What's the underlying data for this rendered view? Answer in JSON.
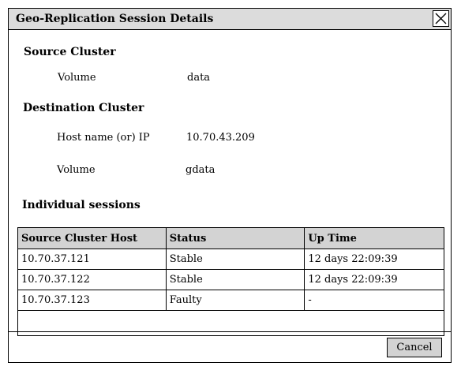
{
  "dialog": {
    "title": "Geo-Replication Session Details",
    "close_icon": "close-icon"
  },
  "source_cluster": {
    "heading": "Source Cluster",
    "volume_label": "Volume",
    "volume_value": "data"
  },
  "destination_cluster": {
    "heading": "Destination Cluster",
    "host_label": "Host name (or) IP",
    "host_value": "10.70.43.209",
    "volume_label": "Volume",
    "volume_value": "gdata"
  },
  "sessions": {
    "heading": "Individual sessions",
    "columns": [
      "Source Cluster Host",
      "Status",
      "Up Time"
    ],
    "rows": [
      [
        "10.70.37.121",
        "Stable",
        "12 days 22:09:39"
      ],
      [
        "10.70.37.122",
        "Stable",
        "12 days 22:09:39"
      ],
      [
        "10.70.37.123",
        "Faulty",
        "-"
      ]
    ]
  },
  "footer": {
    "cancel_label": "Cancel"
  }
}
